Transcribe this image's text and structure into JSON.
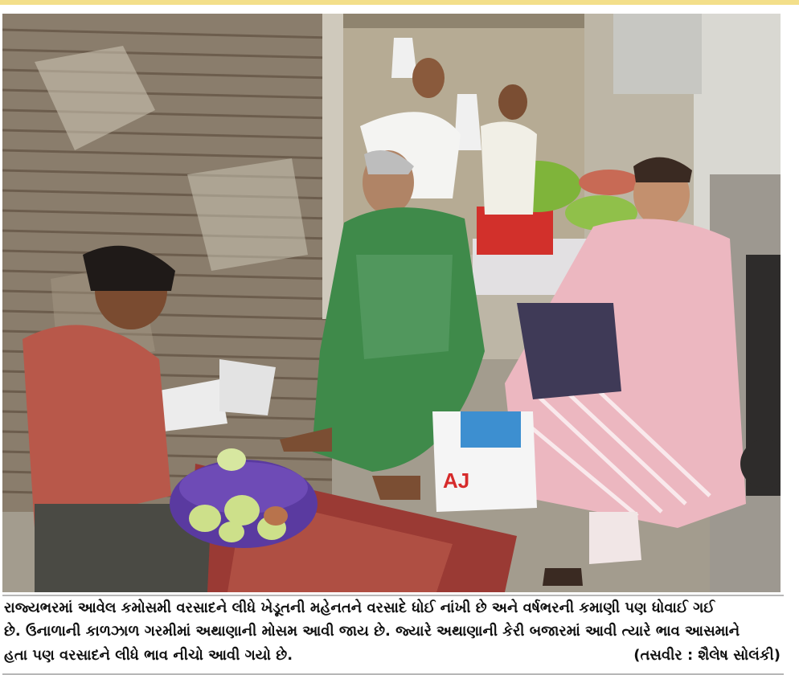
{
  "caption": {
    "line1": "રાજ્યભરમાં આવેલ કમોસમી વરસાદને લીધે ખેડૂતની મહેનતને વરસાદે ધોઈ નાંખી છે અને વર્ષભરની કમાણી પણ ધોવાઈ ગઈ",
    "line2": "છે. ઉનાળાની કાળઝાળ ગરમીમાં અથાણાની મોસમ આવી જાય છે. જ્યારે અથાણાની કેરી બજારમાં આવી ત્યારે ભાવ આસમાને",
    "line3": "હતા પણ વરસાદને લીધે ભાવ નીચો આવી ગયો છે.",
    "credit": "(તસવીર : શૈલેષ સોલંકી)"
  },
  "photo_bag_text": "AJ",
  "colors": {
    "accent_bar": "#f3df8a",
    "rule": "#b7b7b7"
  }
}
